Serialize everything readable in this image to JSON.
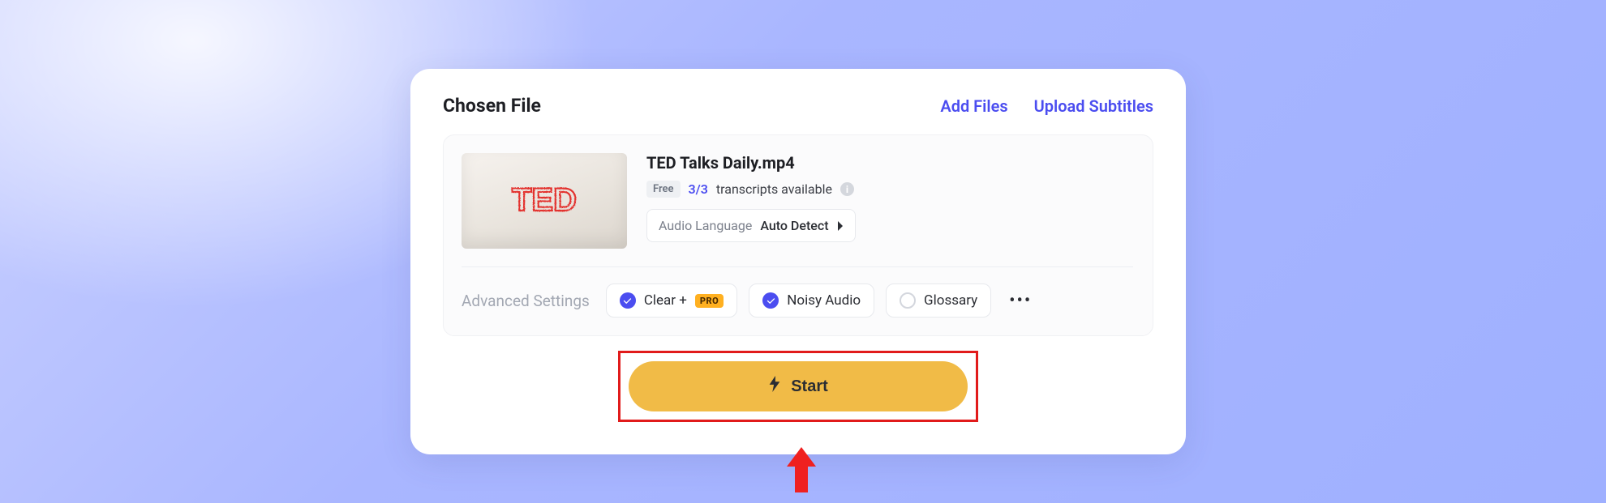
{
  "header": {
    "title": "Chosen File",
    "add_files": "Add Files",
    "upload_subtitles": "Upload Subtitles"
  },
  "file": {
    "thumbnail_text": "TED",
    "name": "TED Talks Daily.mp4",
    "free_badge": "Free",
    "transcript_count": "3/3",
    "transcript_label": "transcripts available",
    "language": {
      "label": "Audio Language",
      "value": "Auto Detect"
    }
  },
  "advanced": {
    "label": "Advanced Settings",
    "options": {
      "clear_plus": {
        "label": "Clear +",
        "pro_badge": "PRO",
        "checked": true
      },
      "noisy_audio": {
        "label": "Noisy Audio",
        "checked": true
      },
      "glossary": {
        "label": "Glossary",
        "checked": false
      }
    }
  },
  "start_button": "Start",
  "colors": {
    "accent": "#4b4df0",
    "highlight_border": "#e11b1b",
    "start_bg": "#f1bb47",
    "pro_bg": "#ffb020"
  }
}
